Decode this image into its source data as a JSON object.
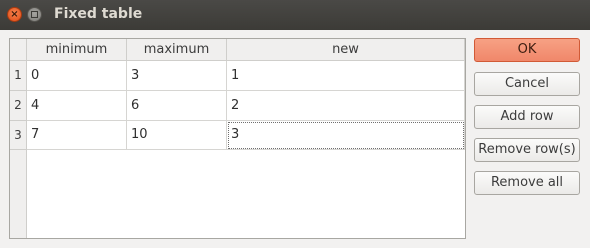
{
  "window": {
    "title": "Fixed table"
  },
  "table": {
    "columns": [
      "minimum",
      "maximum",
      "new"
    ],
    "row_numbers": [
      "1",
      "2",
      "3"
    ],
    "rows": [
      [
        "0",
        "3",
        "1"
      ],
      [
        "4",
        "6",
        "2"
      ],
      [
        "7",
        "10",
        "3"
      ]
    ]
  },
  "buttons": {
    "ok": "OK",
    "cancel": "Cancel",
    "add_row": "Add row",
    "remove_rows": "Remove row(s)",
    "remove_all": "Remove all"
  },
  "colors": {
    "accent": "#f0876a",
    "titlebar": "#3c3b37"
  }
}
